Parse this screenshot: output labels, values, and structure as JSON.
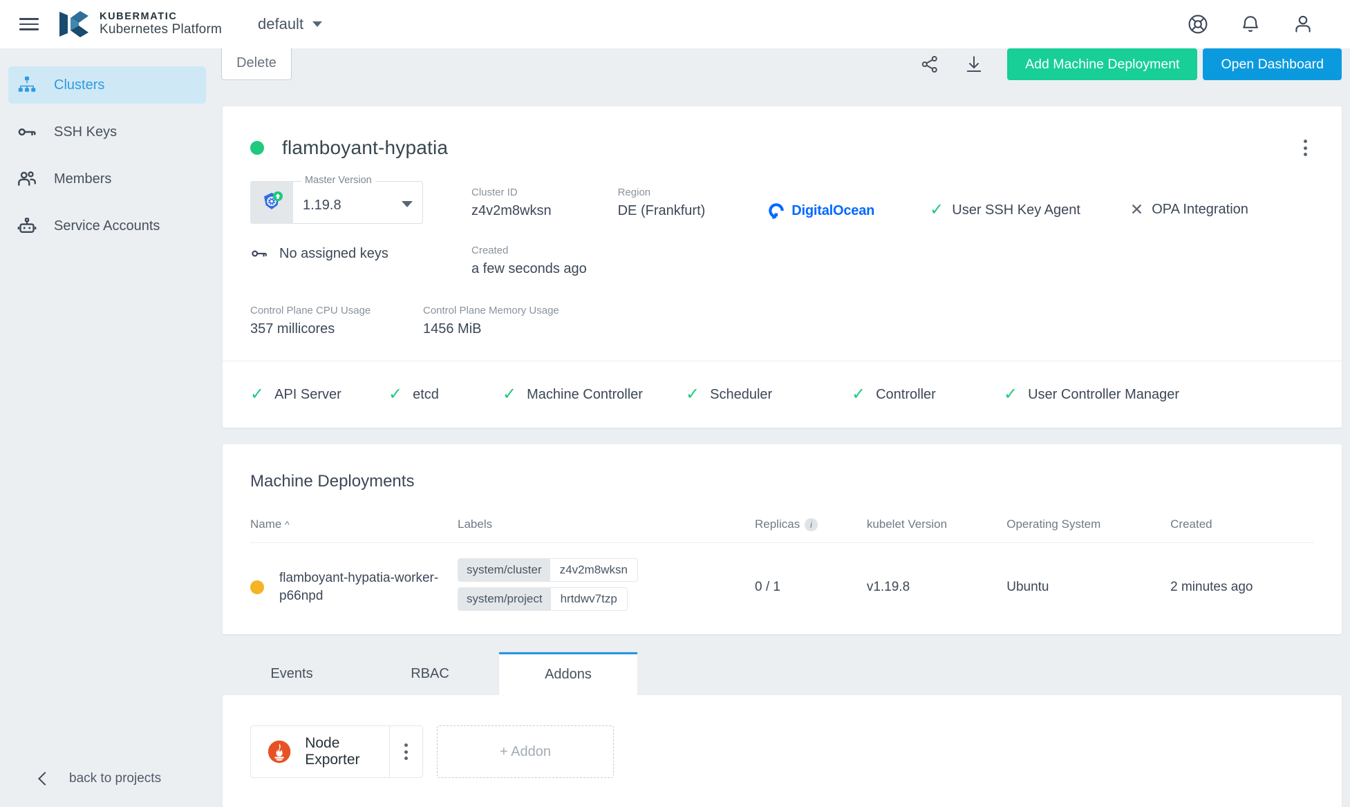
{
  "topbar": {
    "menu_icon": "hamburger-icon",
    "brand_top": "KUBERMATIC",
    "brand_bottom": "Kubernetes Platform",
    "project_selected": "default",
    "icons": [
      "help-icon",
      "notifications-icon",
      "account-icon"
    ]
  },
  "sidebar": {
    "items": [
      {
        "label": "Clusters",
        "icon": "clusters-icon",
        "active": true
      },
      {
        "label": "SSH Keys",
        "icon": "key-icon",
        "active": false
      },
      {
        "label": "Members",
        "icon": "members-icon",
        "active": false
      },
      {
        "label": "Service Accounts",
        "icon": "robot-icon",
        "active": false
      }
    ],
    "back_label": "back to projects"
  },
  "toolbar": {
    "delete_label": "Delete",
    "share_icon": "share-icon",
    "download_icon": "download-icon",
    "add_machine_deployment": "Add Machine Deployment",
    "open_dashboard": "Open Dashboard",
    "teal": "#17cf97",
    "blue": "#0c9ade"
  },
  "cluster": {
    "status": "running",
    "status_color": "#1fc97e",
    "name": "flamboyant-hypatia",
    "master_version_label": "Master Version",
    "master_version": "1.19.8",
    "cluster_id_label": "Cluster ID",
    "cluster_id": "z4v2m8wksn",
    "region_label": "Region",
    "region": "DE (Frankfurt)",
    "provider": "DigitalOcean",
    "provider_color": "#0069ff",
    "ssh_key_agent": "User SSH Key Agent",
    "ssh_key_agent_state": "enabled",
    "opa_integration": "OPA Integration",
    "opa_integration_state": "disabled",
    "keys": "No assigned keys",
    "created_label": "Created",
    "created": "a few seconds ago",
    "cpu_label": "Control Plane CPU Usage",
    "cpu_value": "357 millicores",
    "memory_label": "Control Plane Memory Usage",
    "memory_value": "1456 MiB",
    "health": [
      {
        "label": "API Server",
        "ok": true
      },
      {
        "label": "etcd",
        "ok": true
      },
      {
        "label": "Machine Controller",
        "ok": true
      },
      {
        "label": "Scheduler",
        "ok": true
      },
      {
        "label": "Controller",
        "ok": true
      },
      {
        "label": "User Controller Manager",
        "ok": true
      }
    ]
  },
  "machine_deployments": {
    "title": "Machine Deployments",
    "columns": {
      "name": "Name",
      "sort_caret": "^",
      "labels": "Labels",
      "replicas": "Replicas",
      "kubelet_version": "kubelet Version",
      "operating_system": "Operating System",
      "created": "Created"
    },
    "rows": [
      {
        "status_color": "#f5b425",
        "name": "flamboyant-hypatia-worker-p66npd",
        "labels": [
          {
            "key": "system/cluster",
            "value": "z4v2m8wksn"
          },
          {
            "key": "system/project",
            "value": "hrtdwv7tzp"
          }
        ],
        "replicas": "0 / 1",
        "kubelet_version": "v1.19.8",
        "operating_system": "Ubuntu",
        "created": "2 minutes ago"
      }
    ]
  },
  "tabs": [
    {
      "label": "Events",
      "active": false
    },
    {
      "label": "RBAC",
      "active": false
    },
    {
      "label": "Addons",
      "active": true
    }
  ],
  "addons": {
    "items": [
      {
        "name": "Node Exporter",
        "icon": "prometheus-icon"
      }
    ],
    "add_label": "+ Addon"
  }
}
